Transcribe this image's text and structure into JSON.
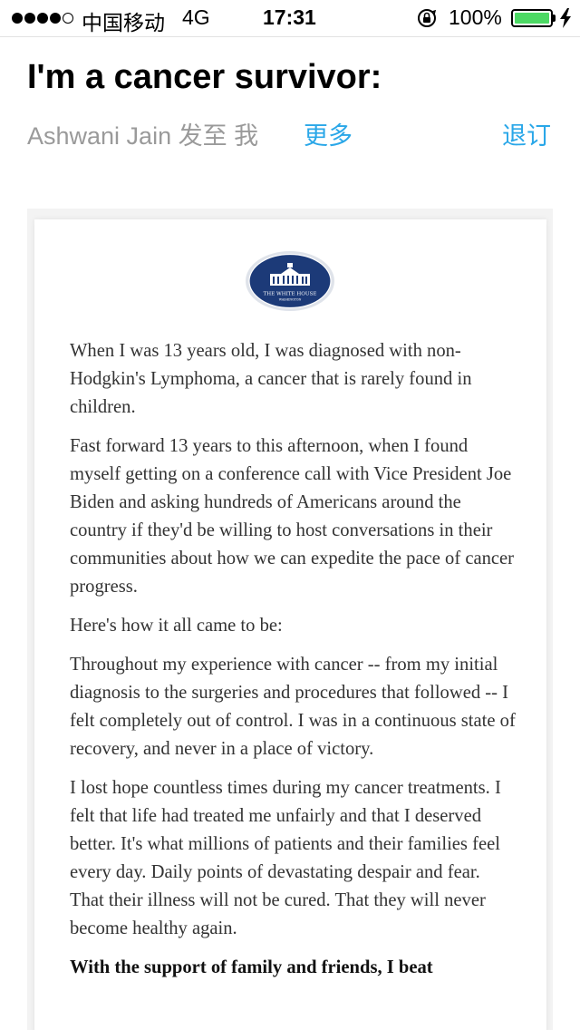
{
  "status_bar": {
    "signal_icon": "signal-dots-icon",
    "carrier": "中国移动",
    "network": "4G",
    "time": "17:31",
    "battery_percent": "100%",
    "battery_level": 1.0,
    "battery_color": "#4cd964"
  },
  "email": {
    "subject": "I'm a cancer survivor:",
    "sender_line": "Ashwani Jain 发至 我",
    "more_label": "更多",
    "unsubscribe_label": "退订",
    "link_color": "#2aa7e8"
  },
  "content": {
    "seal_text": "THE WHITE HOUSE",
    "seal_subtext": "WASHINGTON",
    "paragraphs": [
      "When I was 13 years old, I was diagnosed with non-Hodgkin's Lymphoma, a cancer that is rarely found in children.",
      "Fast forward 13 years to this afternoon, when I found myself getting on a conference call with Vice President Joe Biden and asking hundreds of Americans around the country if they'd be willing to host conversations in their communities about how we can expedite the pace of cancer progress.",
      "Here's how it all came to be:",
      "Throughout my experience with cancer -- from my initial diagnosis to the surgeries and procedures that followed -- I felt completely out of control. I was in a continuous state of recovery, and never in a place of victory.",
      "I lost hope countless times during my cancer treatments. I felt that life had treated me unfairly and that I deserved better. It's what millions of patients and their families feel every day. Daily points of devastating despair and fear. That their illness will not be cured. That they will never become healthy again.",
      "With the support of family and friends, I beat"
    ]
  }
}
